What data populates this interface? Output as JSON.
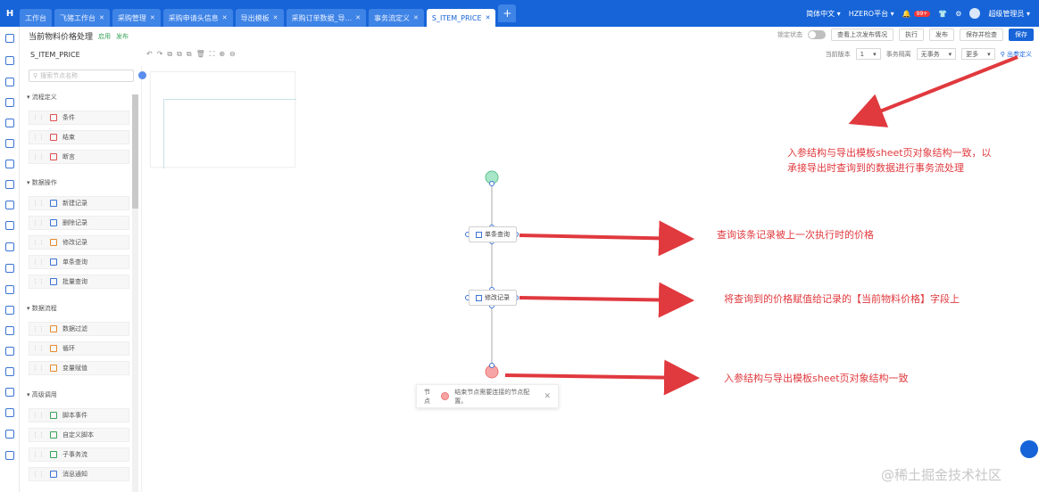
{
  "app": {
    "logo": "H"
  },
  "tabs": [
    {
      "label": "工作台",
      "closable": false,
      "active": false
    },
    {
      "label": "飞猪工作台",
      "closable": true,
      "active": false
    },
    {
      "label": "采购管理",
      "closable": true,
      "active": false
    },
    {
      "label": "采购申请头信息",
      "closable": true,
      "active": false
    },
    {
      "label": "导出模板",
      "closable": true,
      "active": false
    },
    {
      "label": "采购订单数据_导...",
      "closable": true,
      "active": false
    },
    {
      "label": "事务流定义",
      "closable": true,
      "active": false
    },
    {
      "label": "S_ITEM_PRICE",
      "closable": true,
      "active": true
    }
  ],
  "topbar": {
    "lang": "简体中文",
    "platform": "HZERO平台",
    "badge": "99+",
    "user": "超级管理员"
  },
  "page": {
    "title": "当前物料价格处理",
    "tag1": "启用",
    "tag2": "发布"
  },
  "header": {
    "toggle_label": "锁定状态",
    "view_last": "查看上次发布情况",
    "execute": "执行",
    "publish": "发布",
    "save_check": "保存并检查",
    "save": "保存"
  },
  "flow": {
    "name": "S_ITEM_PRICE"
  },
  "toolbar_right": {
    "version_label": "当前版本",
    "version_value": "1",
    "mode_label": "事务隔离",
    "mode_value": "无事务",
    "more": "更多",
    "param_link": "出参定义"
  },
  "panel": {
    "search_placeholder": "搜索节点名称",
    "sections": [
      {
        "title": "流程定义",
        "items": [
          "条件",
          "结束",
          "断言"
        ]
      },
      {
        "title": "数据操作",
        "items": [
          "新建记录",
          "删除记录",
          "修改记录",
          "单条查询",
          "批量查询"
        ]
      },
      {
        "title": "数据流程",
        "items": [
          "数据过滤",
          "循环",
          "变量赋值"
        ]
      },
      {
        "title": "高级调用",
        "items": [
          "脚本事件",
          "自定义脚本",
          "子事务流",
          "消息通知"
        ]
      }
    ]
  },
  "nodes": {
    "query": "单条查询",
    "update": "修改记录"
  },
  "annotations": [
    "入参结构与导出模板sheet页对象结构一致，以",
    "承接导出时查询到的数据进行事务流处理",
    "查询该条记录被上一次执行时的价格",
    "将查询到的价格赋值给记录的【当前物料价格】字段上",
    "入参结构与导出模板sheet页对象结构一致"
  ],
  "tooltip": {
    "label": "节点",
    "text": "结束节点需要连接的节点配置。"
  },
  "watermark": "@稀土掘金技术社区",
  "colors": {
    "primary": "#1664d8",
    "annotation": "#e0393e",
    "start_node": "#a8e6c8",
    "end_node": "#f7a4a4"
  }
}
